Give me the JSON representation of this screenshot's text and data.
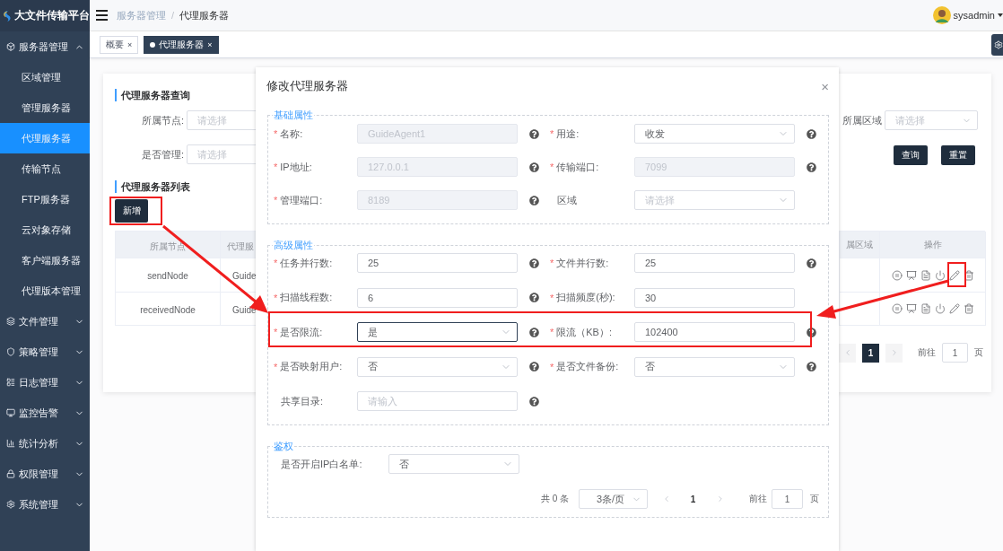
{
  "sidebar": {
    "title": "大文件传输平台",
    "items": [
      {
        "label": "服务器管理",
        "expanded": true,
        "selected": false,
        "children": [
          {
            "label": "区域管理",
            "selected": false
          },
          {
            "label": "管理服务器",
            "selected": false
          },
          {
            "label": "代理服务器",
            "selected": true
          },
          {
            "label": "传输节点",
            "selected": false
          },
          {
            "label": "FTP服务器",
            "selected": false
          },
          {
            "label": "云对象存储",
            "selected": false
          },
          {
            "label": "客户端服务器",
            "selected": false
          },
          {
            "label": "代理版本管理",
            "selected": false
          }
        ]
      },
      {
        "label": "文件管理",
        "expanded": false,
        "selected": false
      },
      {
        "label": "策略管理",
        "expanded": false,
        "selected": false
      },
      {
        "label": "日志管理",
        "expanded": false,
        "selected": false
      },
      {
        "label": "监控告警",
        "expanded": false,
        "selected": false
      },
      {
        "label": "统计分析",
        "expanded": false,
        "selected": false
      },
      {
        "label": "权限管理",
        "expanded": false,
        "selected": false
      },
      {
        "label": "系统管理",
        "expanded": false,
        "selected": false
      }
    ]
  },
  "header": {
    "breadcrumb": [
      "服务器管理",
      "代理服务器"
    ],
    "separator": "/",
    "user": "sysadmin"
  },
  "tabs": [
    {
      "label": "概要",
      "close": "×",
      "selected": false
    },
    {
      "label": "代理服务器",
      "close": "×",
      "selected": true
    }
  ],
  "query": {
    "title": "代理服务器查询",
    "fields": [
      {
        "label": "所属节点:",
        "placeholder": "请选择"
      },
      {
        "label": "是否管理:",
        "placeholder": "请选择"
      },
      {
        "label": "所属区域",
        "placeholder": "请选择"
      }
    ],
    "buttons": [
      "查询",
      "重置"
    ]
  },
  "list": {
    "title": "代理服务器列表",
    "add_button": "新增",
    "columns": [
      "所属节点",
      "代理服",
      "属区域",
      "操作"
    ],
    "rows": [
      {
        "node": "sendNode",
        "name": "Guide"
      },
      {
        "node": "receivedNode",
        "name": "Guide"
      }
    ],
    "pagination": {
      "pages": [
        {
          "label": "1",
          "selected": true
        }
      ],
      "goto_label": "前往",
      "goto_value": "1",
      "goto_suffix": "页"
    }
  },
  "dialog": {
    "title": "修改代理服务器",
    "close": "×",
    "required_mark": "*",
    "sections": [
      {
        "title": "基础属性",
        "fields": [
          {
            "label": "名称:",
            "required": true,
            "kind": "input",
            "value": "GuideAgent1",
            "disabled": true,
            "help": true
          },
          {
            "label": "用途:",
            "required": true,
            "kind": "select",
            "value": "收发",
            "help": true
          },
          {
            "label": "IP地址:",
            "required": true,
            "kind": "input",
            "value": "127.0.0.1",
            "disabled": true,
            "help": true
          },
          {
            "label": "传输端口:",
            "required": true,
            "kind": "input",
            "value": "7099",
            "disabled": true,
            "help": true
          },
          {
            "label": "管理端口:",
            "required": true,
            "kind": "input",
            "value": "8189",
            "disabled": true,
            "help": true
          },
          {
            "label": "区域",
            "required": false,
            "kind": "select",
            "placeholder": "请选择",
            "help": false
          }
        ]
      },
      {
        "title": "高级属性",
        "fields": [
          {
            "label": "任务并行数:",
            "required": true,
            "kind": "input",
            "value": "25",
            "disabled": false,
            "help": true
          },
          {
            "label": "文件并行数:",
            "required": true,
            "kind": "input",
            "value": "25",
            "disabled": false,
            "help": true
          },
          {
            "label": "扫描线程数:",
            "required": true,
            "kind": "input",
            "value": "6",
            "disabled": false,
            "help": true
          },
          {
            "label": "扫描频度(秒):",
            "required": true,
            "kind": "input",
            "value": "30",
            "disabled": false,
            "help": false
          },
          {
            "label": "是否限流:",
            "required": true,
            "kind": "select",
            "value": "是",
            "focused": true,
            "help": true
          },
          {
            "label": "限流（KB）:",
            "required": true,
            "kind": "input",
            "value": "102400",
            "disabled": false,
            "help": true
          },
          {
            "label": "是否映射用户:",
            "required": true,
            "kind": "select",
            "value": "否",
            "help": true
          },
          {
            "label": "是否文件备份:",
            "required": true,
            "kind": "select",
            "value": "否",
            "help": true
          },
          {
            "label": "共享目录:",
            "required": false,
            "kind": "input",
            "placeholder": "请输入",
            "disabled": false,
            "help": true
          }
        ]
      },
      {
        "title": "鉴权",
        "fields": [
          {
            "label": "是否开启IP白名单:",
            "required": false,
            "kind": "select",
            "value": "否",
            "help": false
          }
        ],
        "pagination": {
          "total": "共 0 条",
          "page_size": "3条/页",
          "pages": [
            {
              "label": "1",
              "selected": true
            }
          ],
          "goto_label": "前往",
          "goto_value": "1",
          "goto_suffix": "页"
        }
      }
    ]
  }
}
